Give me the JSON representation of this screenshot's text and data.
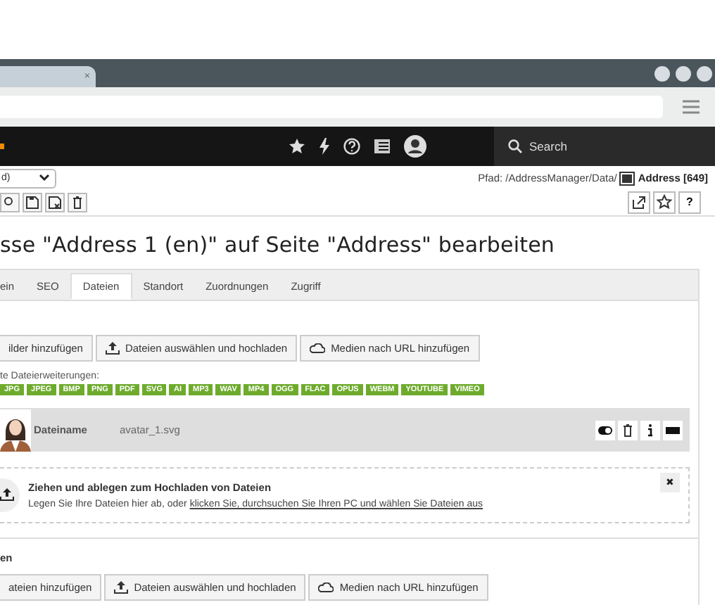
{
  "browser": {
    "tab_close": "×"
  },
  "header": {
    "search_placeholder": "Search"
  },
  "toolbar": {
    "select_value": "d)",
    "path_prefix": "Pfad: /AddressManager/Data/",
    "path_name": "Address [649]",
    "help": "?"
  },
  "title": "sse \"Address 1 (en)\" auf Seite \"Address\" bearbeiten",
  "tabs": [
    {
      "label": "ein",
      "selected": false
    },
    {
      "label": "SEO",
      "selected": false
    },
    {
      "label": "Dateien",
      "selected": true
    },
    {
      "label": "Standort",
      "selected": false
    },
    {
      "label": "Zuordnungen",
      "selected": false
    },
    {
      "label": "Zugriff",
      "selected": false
    }
  ],
  "images": {
    "buttons": [
      {
        "kind": "plain",
        "label": "ilder hinzufügen"
      },
      {
        "kind": "upload",
        "label": "Dateien auswählen und hochladen"
      },
      {
        "kind": "cloud",
        "label": "Medien nach URL hinzufügen"
      }
    ],
    "ext_label": "te Dateierweiterungen:",
    "extensions": [
      "JPG",
      "JPEG",
      "BMP",
      "PNG",
      "PDF",
      "SVG",
      "AI",
      "MP3",
      "WAV",
      "MP4",
      "OGG",
      "FLAC",
      "OPUS",
      "WEBM",
      "YOUTUBE",
      "VIMEO"
    ],
    "file": {
      "label": "Dateiname",
      "value": "avatar_1.svg"
    },
    "dropzone": {
      "title": "Ziehen und ablegen zum Hochladen von Dateien",
      "text": "Legen Sie Ihre Dateien hier ab, oder ",
      "link": "klicken Sie, durchsuchen Sie Ihren PC und wählen Sie Dateien aus",
      "close": "✖"
    }
  },
  "files": {
    "heading": "en",
    "buttons": [
      {
        "kind": "plain",
        "label": "ateien hinzufügen"
      },
      {
        "kind": "upload",
        "label": "Dateien auswählen und hochladen"
      },
      {
        "kind": "cloud",
        "label": "Medien nach URL hinzufügen"
      }
    ]
  }
}
